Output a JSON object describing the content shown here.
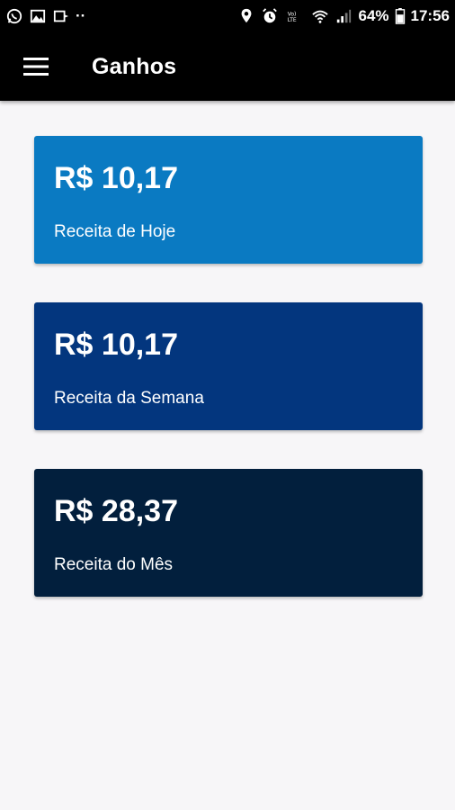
{
  "status_bar": {
    "battery": "64%",
    "time": "17:56",
    "left_icons": [
      "whatsapp-icon",
      "gallery-icon",
      "cast-icon",
      "more-dots-icon"
    ],
    "right_icons": [
      "location-icon",
      "alarm-icon",
      "volte-icon",
      "wifi-icon",
      "signal-icon",
      "battery-icon"
    ],
    "volte_label": "Vo) LTE",
    "more_dots": "··"
  },
  "app_bar": {
    "title": "Ganhos",
    "menu_icon": "hamburger-menu-icon"
  },
  "cards": [
    {
      "value": "R$ 10,17",
      "label": "Receita de Hoje",
      "color": "#0a7ac2"
    },
    {
      "value": "R$ 10,17",
      "label": "Receita da Semana",
      "color": "#03367e"
    },
    {
      "value": "R$ 28,37",
      "label": "Receita do Mês",
      "color": "#021f3d"
    }
  ]
}
